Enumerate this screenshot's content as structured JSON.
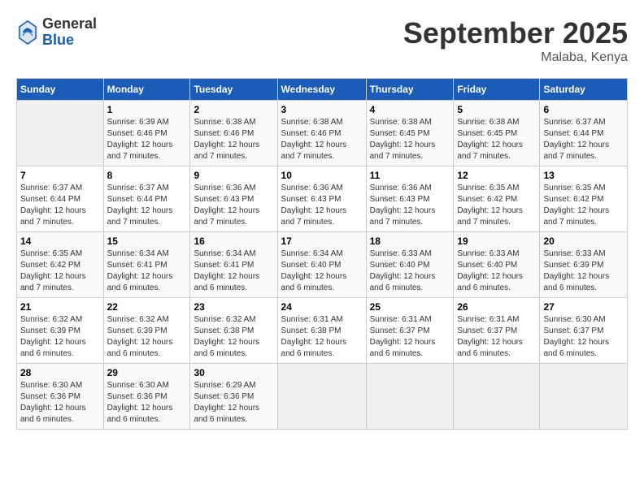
{
  "header": {
    "logo_general": "General",
    "logo_blue": "Blue",
    "month_title": "September 2025",
    "location": "Malaba, Kenya"
  },
  "columns": [
    "Sunday",
    "Monday",
    "Tuesday",
    "Wednesday",
    "Thursday",
    "Friday",
    "Saturday"
  ],
  "weeks": [
    [
      {
        "day": "",
        "empty": true
      },
      {
        "day": "1",
        "sunrise": "Sunrise: 6:39 AM",
        "sunset": "Sunset: 6:46 PM",
        "daylight": "Daylight: 12 hours and 7 minutes."
      },
      {
        "day": "2",
        "sunrise": "Sunrise: 6:38 AM",
        "sunset": "Sunset: 6:46 PM",
        "daylight": "Daylight: 12 hours and 7 minutes."
      },
      {
        "day": "3",
        "sunrise": "Sunrise: 6:38 AM",
        "sunset": "Sunset: 6:46 PM",
        "daylight": "Daylight: 12 hours and 7 minutes."
      },
      {
        "day": "4",
        "sunrise": "Sunrise: 6:38 AM",
        "sunset": "Sunset: 6:45 PM",
        "daylight": "Daylight: 12 hours and 7 minutes."
      },
      {
        "day": "5",
        "sunrise": "Sunrise: 6:38 AM",
        "sunset": "Sunset: 6:45 PM",
        "daylight": "Daylight: 12 hours and 7 minutes."
      },
      {
        "day": "6",
        "sunrise": "Sunrise: 6:37 AM",
        "sunset": "Sunset: 6:44 PM",
        "daylight": "Daylight: 12 hours and 7 minutes."
      }
    ],
    [
      {
        "day": "7",
        "sunrise": "Sunrise: 6:37 AM",
        "sunset": "Sunset: 6:44 PM",
        "daylight": "Daylight: 12 hours and 7 minutes."
      },
      {
        "day": "8",
        "sunrise": "Sunrise: 6:37 AM",
        "sunset": "Sunset: 6:44 PM",
        "daylight": "Daylight: 12 hours and 7 minutes."
      },
      {
        "day": "9",
        "sunrise": "Sunrise: 6:36 AM",
        "sunset": "Sunset: 6:43 PM",
        "daylight": "Daylight: 12 hours and 7 minutes."
      },
      {
        "day": "10",
        "sunrise": "Sunrise: 6:36 AM",
        "sunset": "Sunset: 6:43 PM",
        "daylight": "Daylight: 12 hours and 7 minutes."
      },
      {
        "day": "11",
        "sunrise": "Sunrise: 6:36 AM",
        "sunset": "Sunset: 6:43 PM",
        "daylight": "Daylight: 12 hours and 7 minutes."
      },
      {
        "day": "12",
        "sunrise": "Sunrise: 6:35 AM",
        "sunset": "Sunset: 6:42 PM",
        "daylight": "Daylight: 12 hours and 7 minutes."
      },
      {
        "day": "13",
        "sunrise": "Sunrise: 6:35 AM",
        "sunset": "Sunset: 6:42 PM",
        "daylight": "Daylight: 12 hours and 7 minutes."
      }
    ],
    [
      {
        "day": "14",
        "sunrise": "Sunrise: 6:35 AM",
        "sunset": "Sunset: 6:42 PM",
        "daylight": "Daylight: 12 hours and 7 minutes."
      },
      {
        "day": "15",
        "sunrise": "Sunrise: 6:34 AM",
        "sunset": "Sunset: 6:41 PM",
        "daylight": "Daylight: 12 hours and 6 minutes."
      },
      {
        "day": "16",
        "sunrise": "Sunrise: 6:34 AM",
        "sunset": "Sunset: 6:41 PM",
        "daylight": "Daylight: 12 hours and 6 minutes."
      },
      {
        "day": "17",
        "sunrise": "Sunrise: 6:34 AM",
        "sunset": "Sunset: 6:40 PM",
        "daylight": "Daylight: 12 hours and 6 minutes."
      },
      {
        "day": "18",
        "sunrise": "Sunrise: 6:33 AM",
        "sunset": "Sunset: 6:40 PM",
        "daylight": "Daylight: 12 hours and 6 minutes."
      },
      {
        "day": "19",
        "sunrise": "Sunrise: 6:33 AM",
        "sunset": "Sunset: 6:40 PM",
        "daylight": "Daylight: 12 hours and 6 minutes."
      },
      {
        "day": "20",
        "sunrise": "Sunrise: 6:33 AM",
        "sunset": "Sunset: 6:39 PM",
        "daylight": "Daylight: 12 hours and 6 minutes."
      }
    ],
    [
      {
        "day": "21",
        "sunrise": "Sunrise: 6:32 AM",
        "sunset": "Sunset: 6:39 PM",
        "daylight": "Daylight: 12 hours and 6 minutes."
      },
      {
        "day": "22",
        "sunrise": "Sunrise: 6:32 AM",
        "sunset": "Sunset: 6:39 PM",
        "daylight": "Daylight: 12 hours and 6 minutes."
      },
      {
        "day": "23",
        "sunrise": "Sunrise: 6:32 AM",
        "sunset": "Sunset: 6:38 PM",
        "daylight": "Daylight: 12 hours and 6 minutes."
      },
      {
        "day": "24",
        "sunrise": "Sunrise: 6:31 AM",
        "sunset": "Sunset: 6:38 PM",
        "daylight": "Daylight: 12 hours and 6 minutes."
      },
      {
        "day": "25",
        "sunrise": "Sunrise: 6:31 AM",
        "sunset": "Sunset: 6:37 PM",
        "daylight": "Daylight: 12 hours and 6 minutes."
      },
      {
        "day": "26",
        "sunrise": "Sunrise: 6:31 AM",
        "sunset": "Sunset: 6:37 PM",
        "daylight": "Daylight: 12 hours and 6 minutes."
      },
      {
        "day": "27",
        "sunrise": "Sunrise: 6:30 AM",
        "sunset": "Sunset: 6:37 PM",
        "daylight": "Daylight: 12 hours and 6 minutes."
      }
    ],
    [
      {
        "day": "28",
        "sunrise": "Sunrise: 6:30 AM",
        "sunset": "Sunset: 6:36 PM",
        "daylight": "Daylight: 12 hours and 6 minutes."
      },
      {
        "day": "29",
        "sunrise": "Sunrise: 6:30 AM",
        "sunset": "Sunset: 6:36 PM",
        "daylight": "Daylight: 12 hours and 6 minutes."
      },
      {
        "day": "30",
        "sunrise": "Sunrise: 6:29 AM",
        "sunset": "Sunset: 6:36 PM",
        "daylight": "Daylight: 12 hours and 6 minutes."
      },
      {
        "day": "",
        "empty": true
      },
      {
        "day": "",
        "empty": true
      },
      {
        "day": "",
        "empty": true
      },
      {
        "day": "",
        "empty": true
      }
    ]
  ]
}
